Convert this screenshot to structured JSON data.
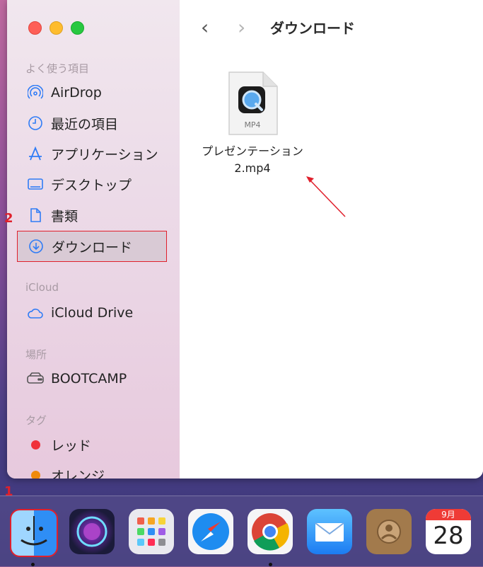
{
  "window": {
    "title": "ダウンロード",
    "nav_back": "‹",
    "nav_forward": "›"
  },
  "sidebar": {
    "sections": [
      {
        "label": "よく使う項目"
      },
      {
        "label": "iCloud"
      },
      {
        "label": "場所"
      },
      {
        "label": "タグ"
      }
    ],
    "favorites": [
      {
        "label": "AirDrop",
        "icon": "airdrop-icon"
      },
      {
        "label": "最近の項目",
        "icon": "clock-icon"
      },
      {
        "label": "アプリケーション",
        "icon": "applications-icon"
      },
      {
        "label": "デスクトップ",
        "icon": "desktop-icon"
      },
      {
        "label": "書類",
        "icon": "document-icon"
      },
      {
        "label": "ダウンロード",
        "icon": "download-icon",
        "selected": true
      }
    ],
    "icloud": [
      {
        "label": "iCloud Drive",
        "icon": "cloud-icon"
      }
    ],
    "locations": [
      {
        "label": "BOOTCAMP",
        "icon": "disk-icon"
      }
    ],
    "tags": [
      {
        "label": "レッド",
        "color": "#f0313a"
      },
      {
        "label": "オレンジ",
        "color": "#f08a0c"
      }
    ]
  },
  "file": {
    "name_line1": "プレゼンテーション",
    "name_line2": "2.mp4",
    "type_label": "MP4"
  },
  "annotations": {
    "badge1": "1",
    "badge2": "2",
    "accent": "#e0202c"
  },
  "calendar": {
    "month": "9月",
    "day": "28"
  },
  "dock": {
    "apps": [
      "finder-icon",
      "siri-icon",
      "launchpad-icon",
      "safari-icon",
      "chrome-icon",
      "mail-icon",
      "contacts-icon",
      "calendar-icon"
    ]
  }
}
